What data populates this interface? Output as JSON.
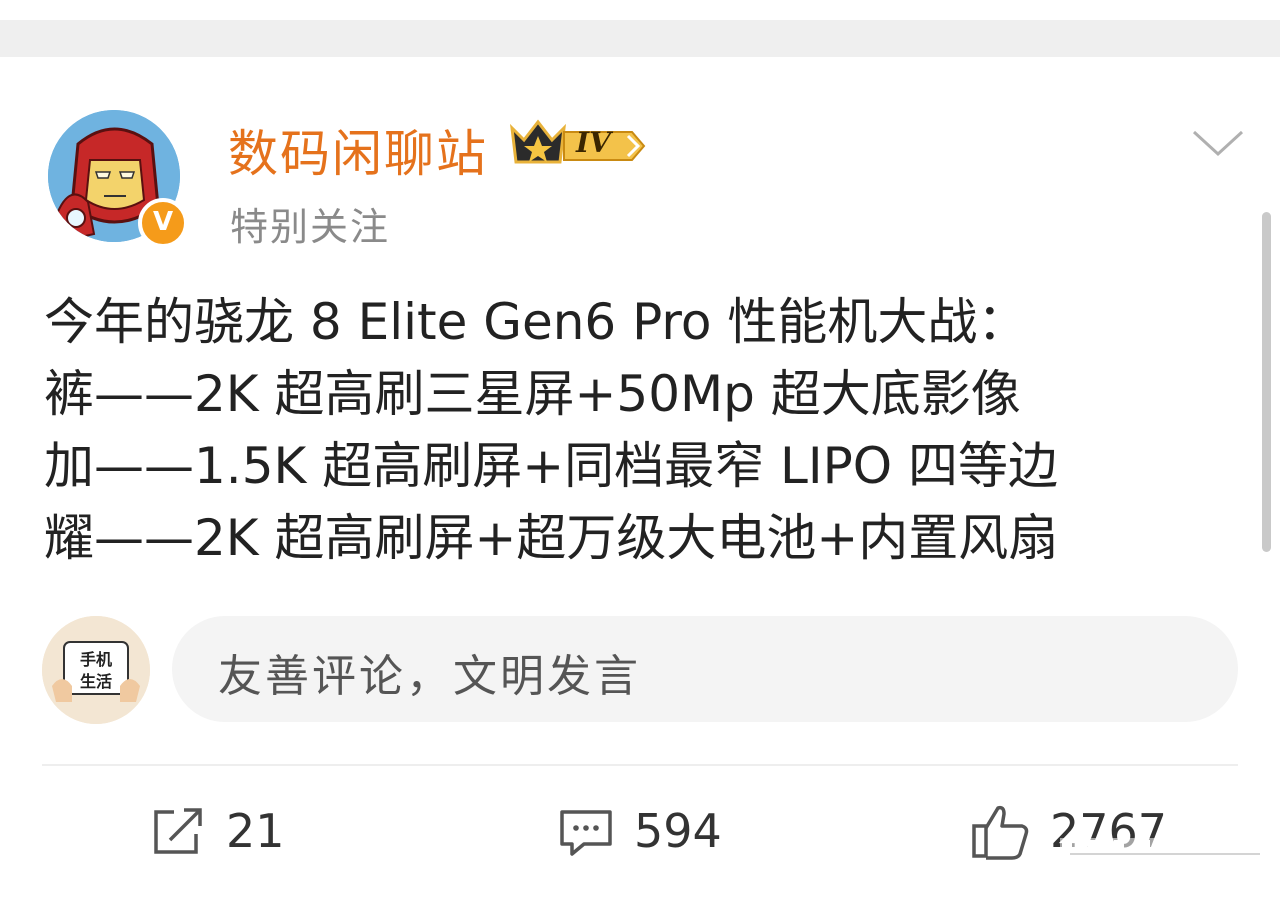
{
  "user": {
    "name": "数码闲聊站",
    "level": "IV",
    "verified_mark": "V",
    "subtitle": "特别关注"
  },
  "post": {
    "lines": [
      "今年的骁龙 8 Elite Gen6 Pro 性能机大战：",
      "裤——2K 超高刷三星屏+50Mp 超大底影像",
      "加——1.5K 超高刷屏+同档最窄 LIPO 四等边",
      "耀——2K 超高刷屏+超万级大电池+内置风扇"
    ]
  },
  "comment": {
    "avatar_lines": [
      "手机",
      "生活"
    ],
    "placeholder": "友善评论，文明发言"
  },
  "actions": {
    "share_count": "21",
    "comment_count": "594",
    "like_count": "2767"
  },
  "icons": {
    "share": "share-icon",
    "comment": "comment-icon",
    "like": "thumbs-up-icon",
    "more": "chevron-down-icon"
  },
  "colors": {
    "username": "#e5721c",
    "verified": "#f59b1a",
    "text": "#222222"
  }
}
